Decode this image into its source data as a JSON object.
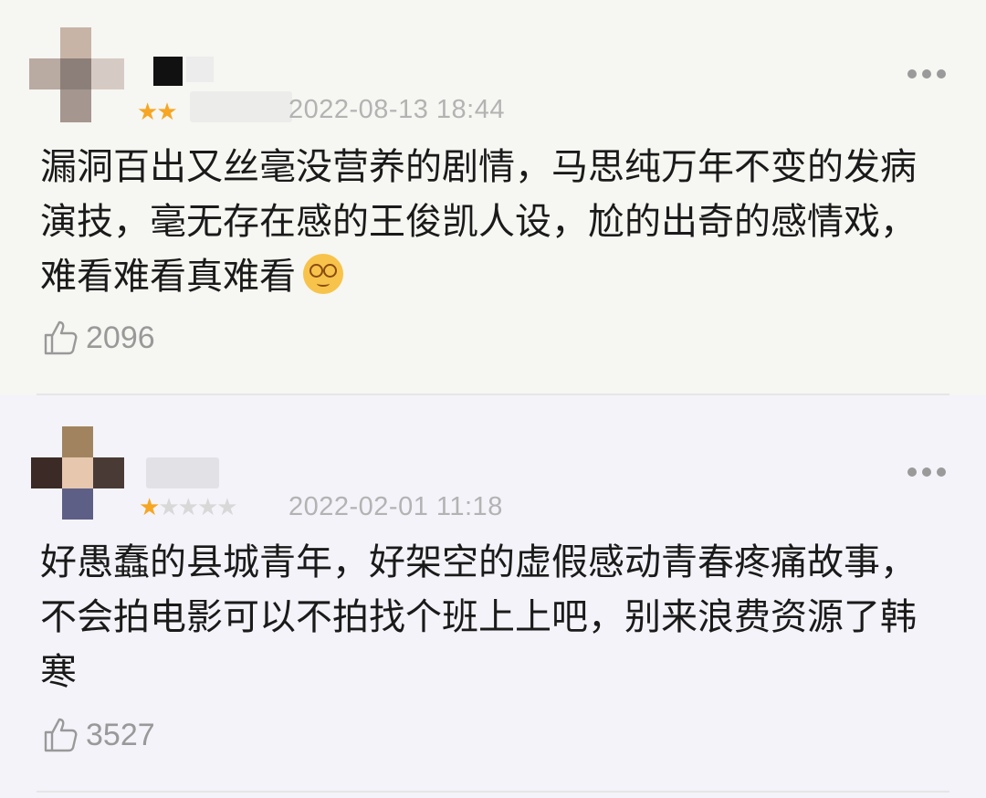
{
  "reviews": [
    {
      "user": {
        "name": ""
      },
      "rating": {
        "stars": 2,
        "max": 5
      },
      "timestamp": "2022-08-13 18:44",
      "content": "漏洞百出又丝毫没营养的剧情，马思纯万年不变的发病演技，毫无存在感的王俊凯人设，尬的出奇的感情戏，难看难看真难看",
      "emoji": "dizzy-face-emoji",
      "likes": "2096"
    },
    {
      "user": {
        "name": ""
      },
      "rating": {
        "stars": 1,
        "max": 5
      },
      "timestamp": "2022-02-01 11:18",
      "content": "好愚蠢的县城青年，好架空的虚假感动青春疼痛故事，不会拍电影可以不拍找个班上上吧，别来浪费资源了韩寒",
      "likes": "3527"
    }
  ],
  "icons": {
    "more": "more-options-icon",
    "like": "thumbs-up-icon",
    "star": "star-icon"
  },
  "colors": {
    "star_active": "#f6a623",
    "star_inactive": "#d8d8d8",
    "meta_text": "#b3b3b3",
    "body_text": "#1a1a1a"
  }
}
